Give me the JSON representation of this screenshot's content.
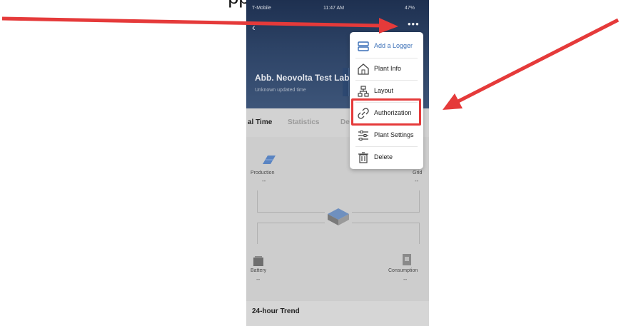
{
  "caption": "pping   g  . .       . . .  page  ",
  "status_bar": {
    "carrier": "T-Mobile",
    "time": "11:47 AM",
    "battery": "47%"
  },
  "header": {
    "plant_name": "Abb. Neovolta Test Lab",
    "updated": "Unknown updated time",
    "more_icon": "more-dots-icon",
    "back_icon": "back-arrow-icon"
  },
  "tabs": [
    {
      "label": "al Time",
      "active": true
    },
    {
      "label": "Statistics",
      "active": false
    },
    {
      "label": "De",
      "active": false
    }
  ],
  "flow": {
    "production": {
      "label": "Production",
      "value": "--"
    },
    "grid": {
      "label": "Grid",
      "value": "--"
    },
    "battery": {
      "label": "Battery",
      "value": "--"
    },
    "consumption": {
      "label": "Consumption",
      "value": "--"
    }
  },
  "trend": {
    "title": "24-hour Trend"
  },
  "menu": {
    "items": [
      {
        "label": "Add a Logger",
        "icon": "logger-icon"
      },
      {
        "label": "Plant Info",
        "icon": "home-icon"
      },
      {
        "label": "Layout",
        "icon": "layout-icon"
      },
      {
        "label": "Authorization",
        "icon": "link-icon",
        "highlighted": true
      },
      {
        "label": "Plant Settings",
        "icon": "settings-sliders-icon"
      },
      {
        "label": "Delete",
        "icon": "trash-icon"
      }
    ]
  },
  "colors": {
    "annotation_red": "#e53a3a",
    "accent_blue": "#3a6fb7"
  }
}
